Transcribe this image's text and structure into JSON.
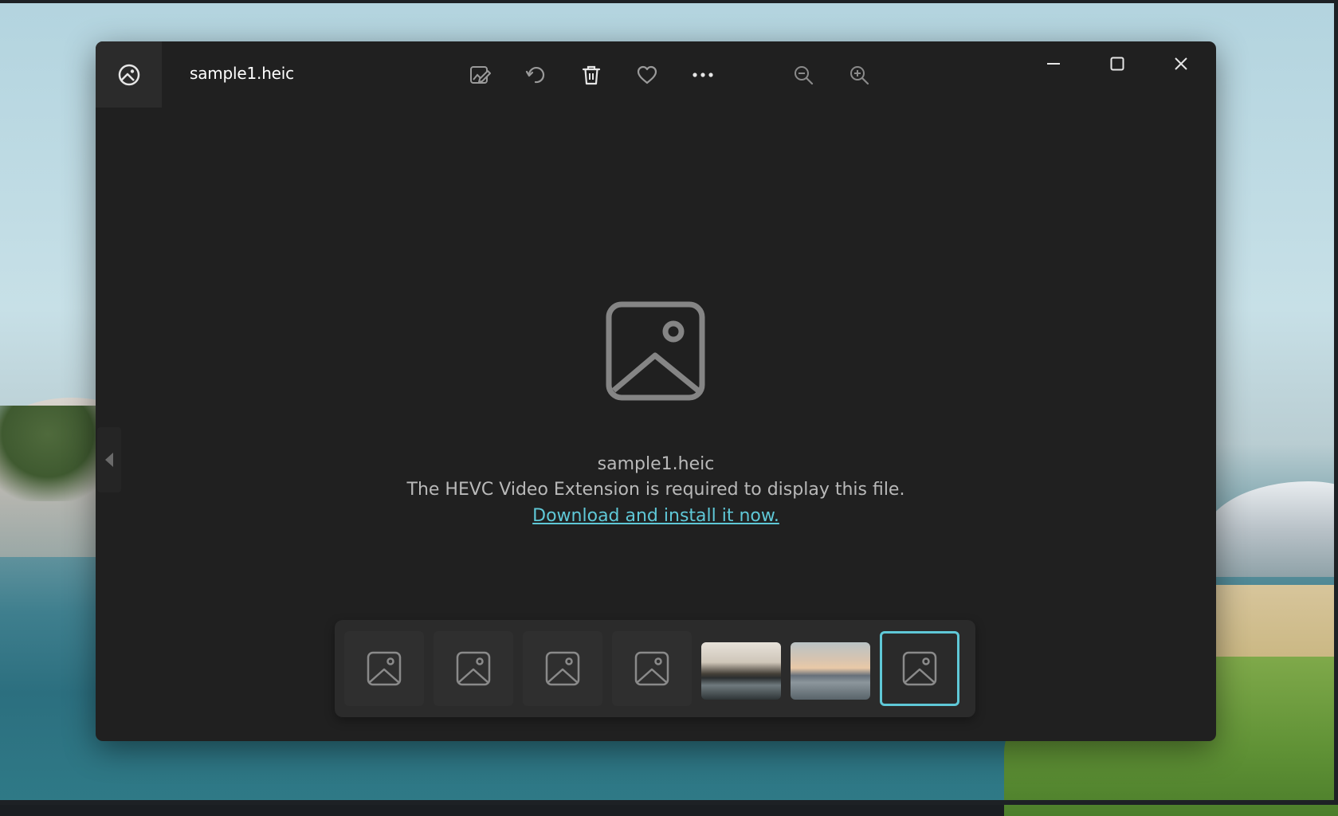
{
  "window": {
    "file_title": "sample1.heic",
    "toolbar": [
      {
        "name": "edit-image-icon"
      },
      {
        "name": "rotate-icon"
      },
      {
        "name": "delete-icon"
      },
      {
        "name": "favorite-icon"
      },
      {
        "name": "more-options-icon"
      },
      {
        "name": "zoom-out-icon"
      },
      {
        "name": "zoom-in-icon"
      }
    ],
    "controls": [
      "minimize-icon",
      "maximize-icon",
      "close-icon"
    ]
  },
  "message": {
    "file_name": "sample1.heic",
    "text": "The HEVC Video Extension is required to display this file.",
    "link": "Download and install it now."
  },
  "filmstrip": {
    "items": [
      {
        "type": "placeholder"
      },
      {
        "type": "placeholder"
      },
      {
        "type": "placeholder"
      },
      {
        "type": "placeholder"
      },
      {
        "type": "photo"
      },
      {
        "type": "photo"
      },
      {
        "type": "placeholder",
        "selected": true
      }
    ]
  },
  "colors": {
    "accent": "#5fc8d7",
    "window_bg": "#202020",
    "text": "#b9b9b9"
  }
}
